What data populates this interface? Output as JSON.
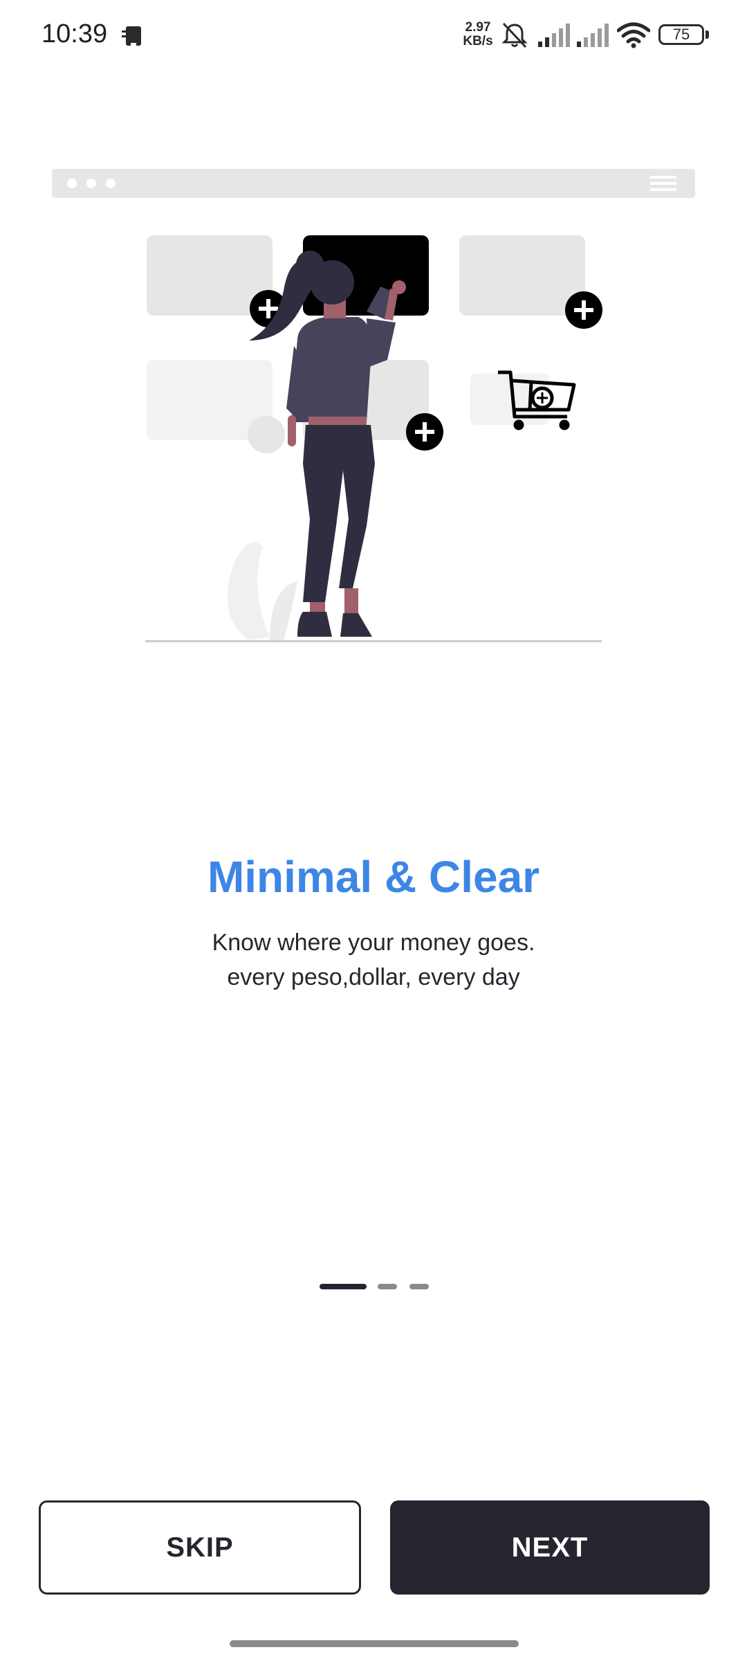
{
  "status_bar": {
    "time": "10:39",
    "net_speed_value": "2.97",
    "net_speed_unit": "KB/s",
    "battery": "75",
    "icons": [
      "notification-device-icon",
      "mute-icon",
      "signal-icon",
      "signal-icon",
      "wifi-icon",
      "battery-icon"
    ]
  },
  "onboarding": {
    "title": "Minimal & Clear",
    "description_line1": "Know where your money goes.",
    "description_line2": "every peso,dollar, every day",
    "page_indicator": {
      "current": 1,
      "total": 3
    }
  },
  "buttons": {
    "skip_label": "SKIP",
    "next_label": "NEXT"
  },
  "colors": {
    "accent": "#3d86e6",
    "primary_dark": "#26252f",
    "placeholder_gray": "#e6e6e6"
  }
}
